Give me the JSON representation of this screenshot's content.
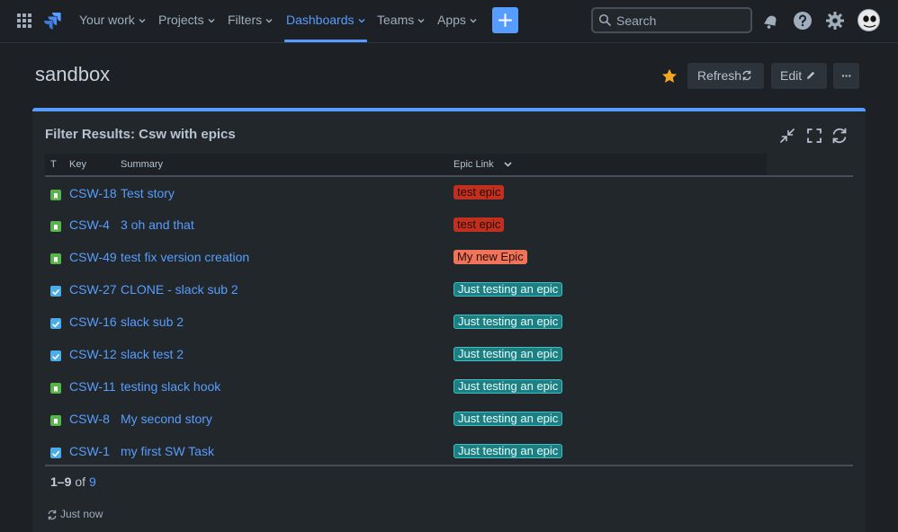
{
  "nav": {
    "items": [
      "Your work",
      "Projects",
      "Filters",
      "Dashboards",
      "Teams",
      "Apps"
    ],
    "active": "Dashboards",
    "search_placeholder": "Search",
    "accent": "#579dff",
    "icons": [
      "apps-grid-icon",
      "jira-logo-icon",
      "plus-icon",
      "search-icon",
      "notification-icon",
      "help-icon",
      "settings-icon",
      "avatar"
    ]
  },
  "page": {
    "title": "sandbox",
    "refresh_label": "Refresh",
    "edit_label": "Edit",
    "more_label": "···",
    "star_color": "#f5a623"
  },
  "gadget": {
    "title": "Filter Results: Csw with epics",
    "columns": [
      "T",
      "Key",
      "Summary",
      "Epic Link"
    ],
    "rows": [
      {
        "type": "story",
        "key": "CSW-18",
        "summary": "Test story",
        "epic": "test epic",
        "epic_color": "red"
      },
      {
        "type": "story",
        "key": "CSW-4",
        "summary": "3 oh and that",
        "epic": "test epic",
        "epic_color": "red"
      },
      {
        "type": "story",
        "key": "CSW-49",
        "summary": "test fix version creation",
        "epic": "My new Epic",
        "epic_color": "orange"
      },
      {
        "type": "task",
        "key": "CSW-27",
        "summary": "CLONE - slack sub 2",
        "epic": "Just testing an epic",
        "epic_color": "teal"
      },
      {
        "type": "task",
        "key": "CSW-16",
        "summary": "slack sub 2",
        "epic": "Just testing an epic",
        "epic_color": "teal"
      },
      {
        "type": "task",
        "key": "CSW-12",
        "summary": "slack test 2",
        "epic": "Just testing an epic",
        "epic_color": "teal"
      },
      {
        "type": "story",
        "key": "CSW-11",
        "summary": "testing slack hook",
        "epic": "Just testing an epic",
        "epic_color": "teal"
      },
      {
        "type": "story",
        "key": "CSW-8",
        "summary": "My second story",
        "epic": "Just testing an epic",
        "epic_color": "teal"
      },
      {
        "type": "task",
        "key": "CSW-1",
        "summary": "my first SW Task",
        "epic": "Just testing an epic",
        "epic_color": "teal"
      }
    ],
    "pager_range": "1–9",
    "pager_of": "of",
    "pager_total": "9",
    "last_refreshed": "Just now"
  }
}
